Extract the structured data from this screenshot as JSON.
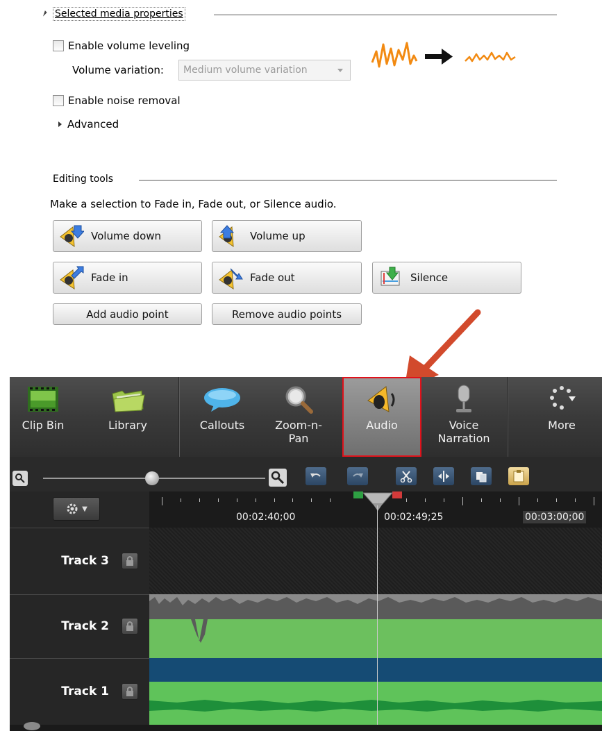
{
  "properties": {
    "section_title": "Selected media properties",
    "volume_leveling_label": "Enable volume leveling",
    "volume_variation_label": "Volume variation:",
    "volume_variation_value": "Medium volume variation",
    "noise_removal_label": "Enable noise removal",
    "advanced_label": "Advanced"
  },
  "editing": {
    "section_title": "Editing tools",
    "description": "Make a selection to Fade in, Fade out, or Silence audio.",
    "buttons": {
      "volume_down": "Volume down",
      "volume_up": "Volume up",
      "fade_in": "Fade in",
      "fade_out": "Fade out",
      "silence": "Silence",
      "add_audio_point": "Add audio point",
      "remove_audio_points": "Remove audio points"
    }
  },
  "toolbar": {
    "items": [
      {
        "label": "Clip Bin",
        "icon": "film-icon"
      },
      {
        "label": "Library",
        "icon": "folder-icon"
      },
      {
        "label": "Callouts",
        "icon": "speech-bubble-icon"
      },
      {
        "label": "Zoom-n-Pan",
        "icon": "magnifier-icon"
      },
      {
        "label": "Audio",
        "icon": "speaker-icon",
        "active": true
      },
      {
        "label": "Voice Narration",
        "icon": "microphone-icon"
      },
      {
        "label": "More",
        "icon": "more-icon"
      }
    ]
  },
  "timeline": {
    "time_labels": [
      "00:02:40;00",
      "00:02:49;25",
      "00:03:00;00"
    ],
    "tracks": [
      "Track 3",
      "Track 2",
      "Track 1"
    ]
  },
  "colors": {
    "active_border": "#e0121b",
    "arrow": "#d24a2c",
    "track2_clip": "#6cc05e",
    "track1_clip": "#1e8f3a",
    "track1_band": "#154b74"
  }
}
